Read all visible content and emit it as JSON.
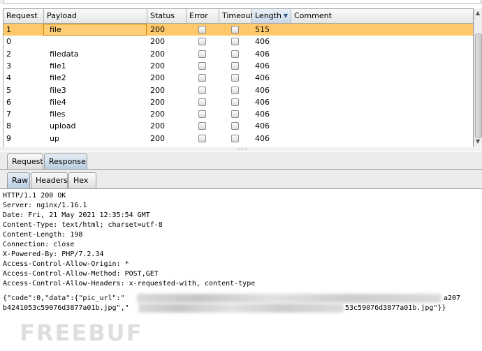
{
  "table": {
    "columns": [
      "Request",
      "Payload",
      "Status",
      "Error",
      "Timeout",
      "Length",
      "Comment"
    ],
    "sorted_column": "Length",
    "rows": [
      {
        "request": "1",
        "payload": "file",
        "status": "200",
        "length": "515",
        "selected": true
      },
      {
        "request": "0",
        "payload": "",
        "status": "200",
        "length": "406"
      },
      {
        "request": "2",
        "payload": "filedata",
        "status": "200",
        "length": "406"
      },
      {
        "request": "3",
        "payload": "file1",
        "status": "200",
        "length": "406"
      },
      {
        "request": "4",
        "payload": "file2",
        "status": "200",
        "length": "406"
      },
      {
        "request": "5",
        "payload": "file3",
        "status": "200",
        "length": "406"
      },
      {
        "request": "6",
        "payload": "file4",
        "status": "200",
        "length": "406"
      },
      {
        "request": "7",
        "payload": "files",
        "status": "200",
        "length": "406"
      },
      {
        "request": "8",
        "payload": "upload",
        "status": "200",
        "length": "406"
      },
      {
        "request": "9",
        "payload": "up",
        "status": "200",
        "length": "406"
      }
    ]
  },
  "tabs": {
    "request": "Request",
    "response": "Response",
    "active": "Response"
  },
  "subtabs": {
    "raw": "Raw",
    "headers": "Headers",
    "hex": "Hex",
    "active": "Raw"
  },
  "response_lines": [
    "HTTP/1.1 200 OK",
    "Server: nginx/1.16.1",
    "Date: Fri, 21 May 2021 12:35:54 GMT",
    "Content-Type: text/html; charset=utf-8",
    "Content-Length: 198",
    "Connection: close",
    "X-Powered-By: PHP/7.2.34",
    "Access-Control-Allow-Origin: *",
    "Access-Control-Allow-Method: POST,GET",
    "Access-Control-Allow-Headers: x-requested-with, content-type"
  ],
  "body": {
    "line1_start": "{\"code\":0,\"data\":{\"pic_url\":\"",
    "line1_end": "a207",
    "line2_start": "b4241053c59076d3877a01b.jpg\",\"",
    "line2_end": "53c59076d3877a01b.jpg\"}}"
  },
  "watermark": "FREEBUF"
}
